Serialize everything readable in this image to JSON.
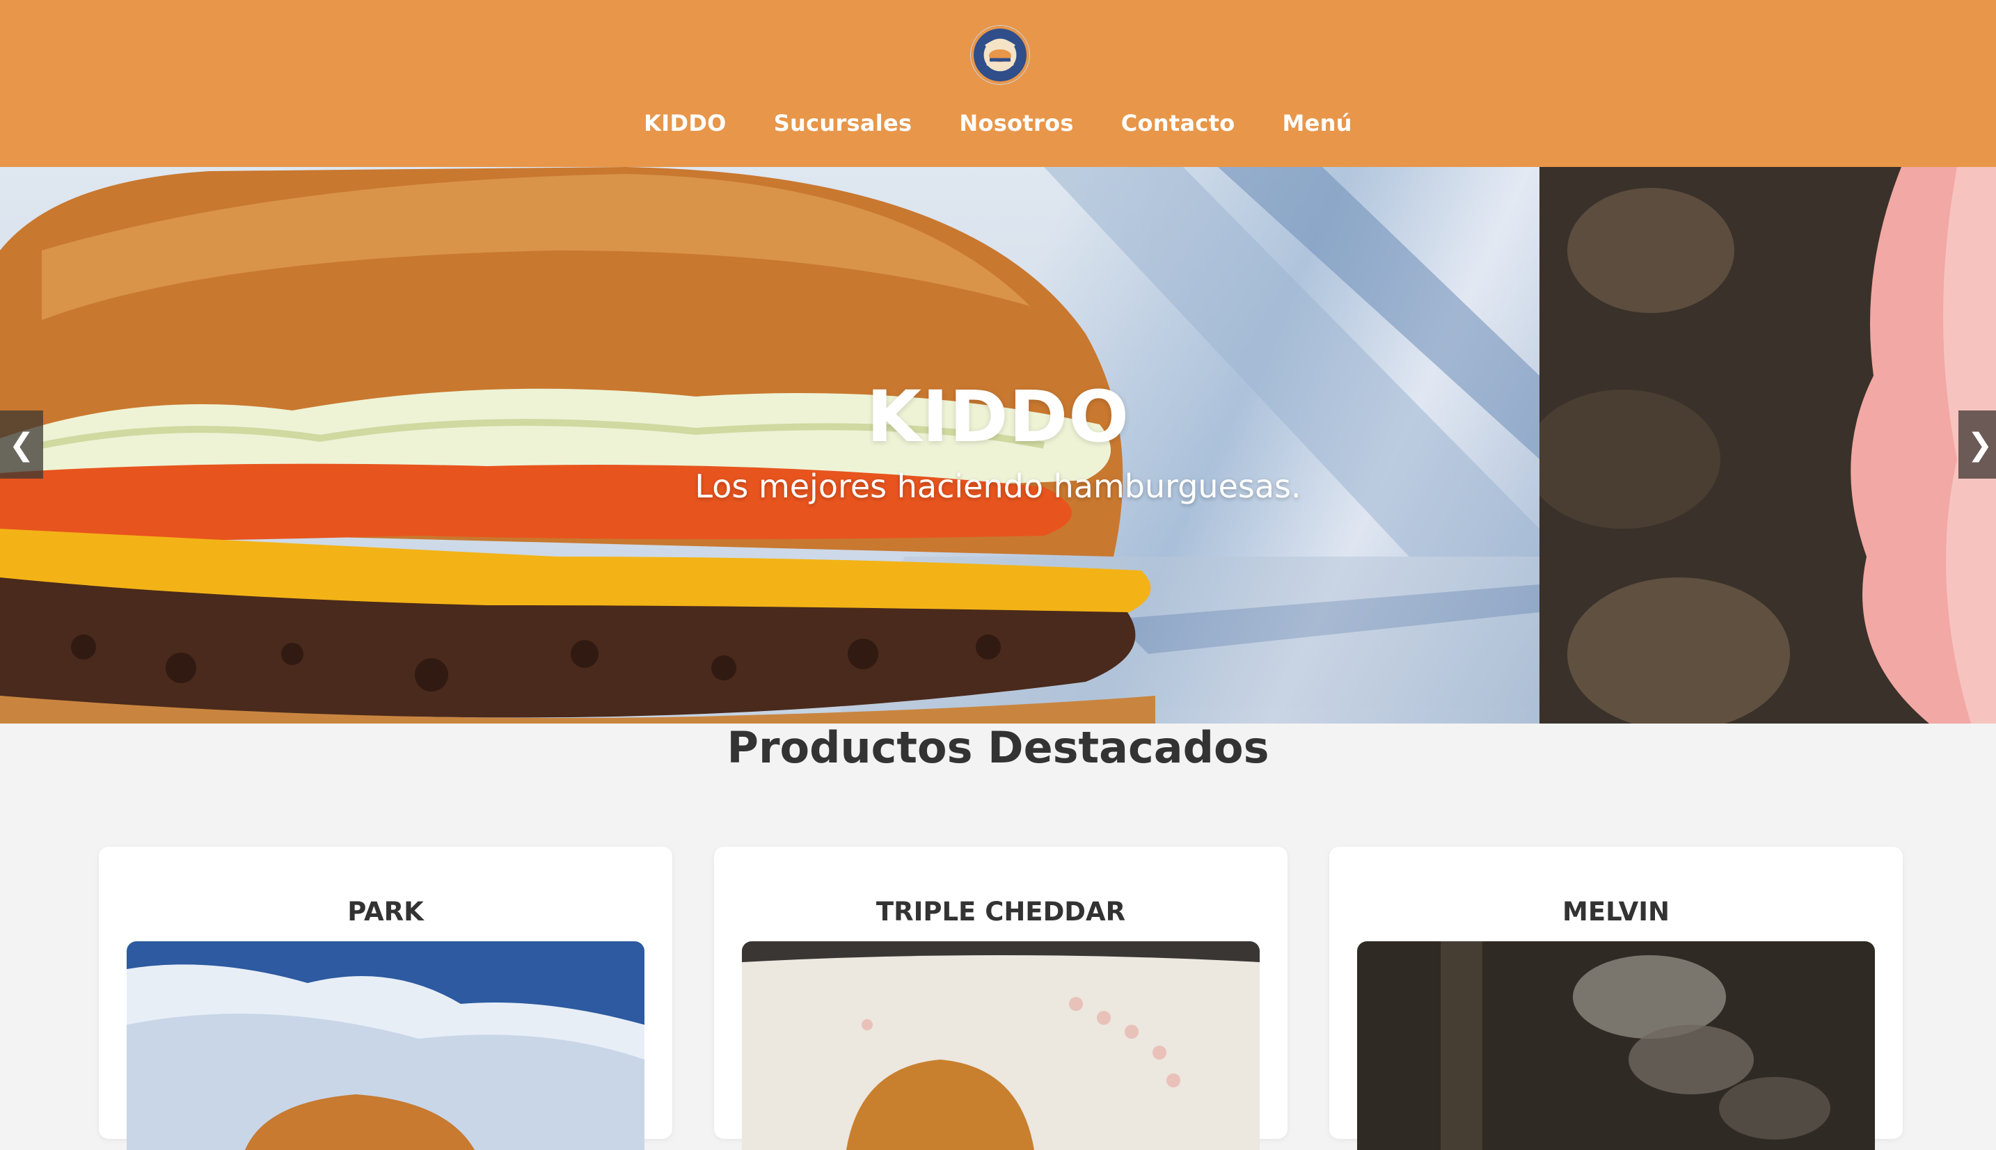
{
  "header": {
    "logo_icon": "kiddo-hamburguesas-logo",
    "background": "#e8964a"
  },
  "nav": {
    "items": [
      {
        "label": "KIDDO"
      },
      {
        "label": "Sucursales"
      },
      {
        "label": "Nosotros"
      },
      {
        "label": "Contacto"
      },
      {
        "label": "Menú"
      }
    ]
  },
  "hero": {
    "title": "KIDDO",
    "subtitle": "Los mejores haciendo hamburguesas.",
    "prev_arrow": "❮",
    "next_arrow": "❯"
  },
  "featured": {
    "title": "Productos Destacados",
    "products": [
      {
        "name": "PARK"
      },
      {
        "name": "TRIPLE CHEDDAR"
      },
      {
        "name": "MELVIN"
      }
    ]
  }
}
